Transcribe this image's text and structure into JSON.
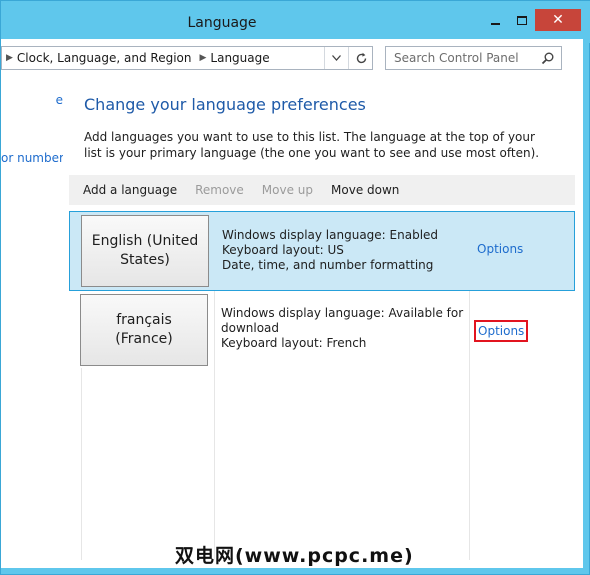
{
  "window": {
    "title": "Language",
    "controls": {
      "minimize": "minimize-icon",
      "maximize": "maximize-icon",
      "close": "close-icon"
    }
  },
  "address_bar": {
    "breadcrumbs": [
      "Clock, Language, and Region",
      "Language"
    ],
    "refresh_icon": "refresh-icon",
    "dropdown_icon": "chevron-down-icon"
  },
  "search": {
    "placeholder": "Search Control Panel",
    "icon": "search-icon"
  },
  "sidebar": {
    "links": [
      "e",
      "or number"
    ]
  },
  "main": {
    "heading": "Change your language preferences",
    "description": "Add languages you want to use to this list. The language at the top of your list is your primary language (the one you want to see and use most often).",
    "toolbar": {
      "add": "Add a language",
      "remove": "Remove",
      "move_up": "Move up",
      "move_down": "Move down"
    },
    "languages": [
      {
        "name": "English (United States)",
        "details": [
          "Windows display language: Enabled",
          "Keyboard layout: US",
          "Date, time, and number formatting"
        ],
        "options": "Options",
        "selected": true
      },
      {
        "name": "français (France)",
        "details": [
          "Windows display language: Available for download",
          "Keyboard layout: French"
        ],
        "options": "Options",
        "selected": false
      }
    ]
  },
  "watermark": "双电网(www.pcpc.me)",
  "colors": {
    "window_frame": "#5fc7ec",
    "close_button": "#c7453a",
    "link": "#1e6ccd",
    "heading": "#1e5aa8",
    "selected_row": "#cbe8f6",
    "highlight_box": "#e2141f"
  }
}
